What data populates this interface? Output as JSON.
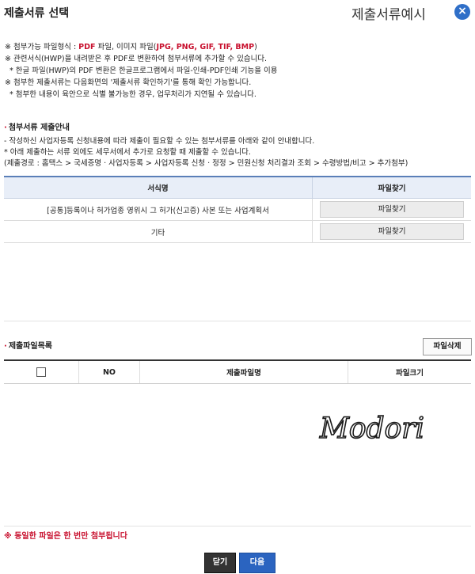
{
  "header": {
    "title": "제출서류 선택",
    "example_label": "제출서류예시",
    "close_label": "×"
  },
  "notice": {
    "l1_prefix": "※ 첨부가능 파일형식 : ",
    "l1_pdf": "PDF",
    "l1_mid": " 파일, 이미지 파일(",
    "l1_types": "JPG, PNG, GIF, TIF, BMP",
    "l1_end": ")",
    "l2": "※ 관련서식(HWP)을 내려받은 후 PDF로 변환하여 첨부서류에 추가할 수 있습니다.",
    "l3": "* 한글 파일(HWP)의 PDF 변환은 한글프로그램에서 파일-인쇄-PDF인쇄 기능을 이용",
    "l4": "※ 첨부한 제출서류는 다음화면의 '제출서류 확인하기'를 통해 확인 가능합니다.",
    "l5": "* 첨부한 내용이 육안으로 식별 불가능한 경우, 업무처리가 지연될 수 있습니다."
  },
  "guide": {
    "title": "첨부서류 제출안내",
    "l1": "- 작성하신 사업자등록 신청내용에 따라 제출이 필요할 수 있는 첨부서류를 아래와 같이 안내합니다.",
    "l2": "* 아래 제출하는 서류 외에도 세무서에서 추가로 요청할 때 제출할 수 있습니다.",
    "l3": "(제출경로 : 홈택스 > 국세증명 · 사업자등록 > 사업자등록 신청 · 정정 > 민원신청 처리결과 조회 > 수령방법/비고 > 추가첨부)"
  },
  "doc_table": {
    "col_name": "서식명",
    "col_find": "파일찾기",
    "rows": [
      {
        "name": "[공통]등록이나 허가업종 영위시 그 허가(신고증) 사본 또는 사업계획서",
        "button": "파일찾기"
      },
      {
        "name": "기타",
        "button": "파일찾기"
      }
    ]
  },
  "file_list": {
    "title": "제출파일목록",
    "delete_button": "파일삭제",
    "col_no": "NO",
    "col_name": "제출파일명",
    "col_size": "파일크기"
  },
  "watermark": "Modori",
  "warning": "※ 동일한 파일은 한 번만 첨부됩니다",
  "buttons": {
    "close": "닫기",
    "next": "다음"
  }
}
